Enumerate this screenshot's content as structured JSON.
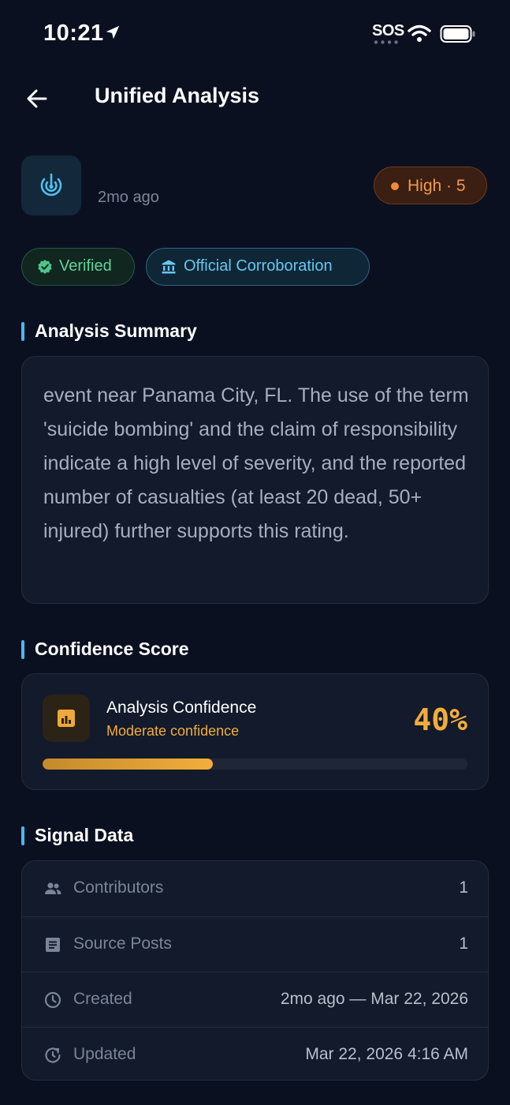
{
  "status_bar": {
    "time": "10:21",
    "sos": "SOS",
    "icons": [
      "location-arrow-icon",
      "wifi-icon",
      "battery-icon"
    ]
  },
  "header": {
    "title": "Unified Analysis",
    "back_icon": "arrow-left-icon"
  },
  "event": {
    "icon": "signal-target-icon",
    "time_ago": "2mo ago",
    "severity": "High · 5",
    "severity_color": "#f08a3c"
  },
  "badges": [
    {
      "label": "Verified",
      "icon": "check-badge-icon",
      "color": "#5fd49a"
    },
    {
      "label": "Official Corroboration",
      "icon": "institution-icon",
      "color": "#66c7ee"
    }
  ],
  "analysis_summary": {
    "title": "Analysis Summary",
    "text": "event near Panama City, FL. The use of the term 'suicide bombing' and the claim of responsibility indicate a high level of severity, and the reported number of casualties (at least 20 dead, 50+ injured) further supports this rating."
  },
  "confidence": {
    "section_title": "Confidence Score",
    "title": "Analysis Confidence",
    "subtitle": "Moderate confidence",
    "value_label": "40%",
    "value_fraction": 0.4,
    "icon": "bar-chart-icon",
    "accent": "#f2ac3c"
  },
  "signal_data": {
    "title": "Signal Data",
    "rows": [
      {
        "label": "Contributors",
        "value": "1",
        "icon": "people-icon"
      },
      {
        "label": "Source Posts",
        "value": "1",
        "icon": "article-icon"
      },
      {
        "label": "Created",
        "value": "2mo ago — Mar 22, 2026",
        "icon": "clock-icon"
      },
      {
        "label": "Updated",
        "value": "Mar 22, 2026 4:16 AM",
        "icon": "refresh-clock-icon"
      }
    ]
  },
  "accent_colors": {
    "section_bar": "#48b9f0",
    "background": "#0b1020",
    "card": "#121a2b"
  }
}
